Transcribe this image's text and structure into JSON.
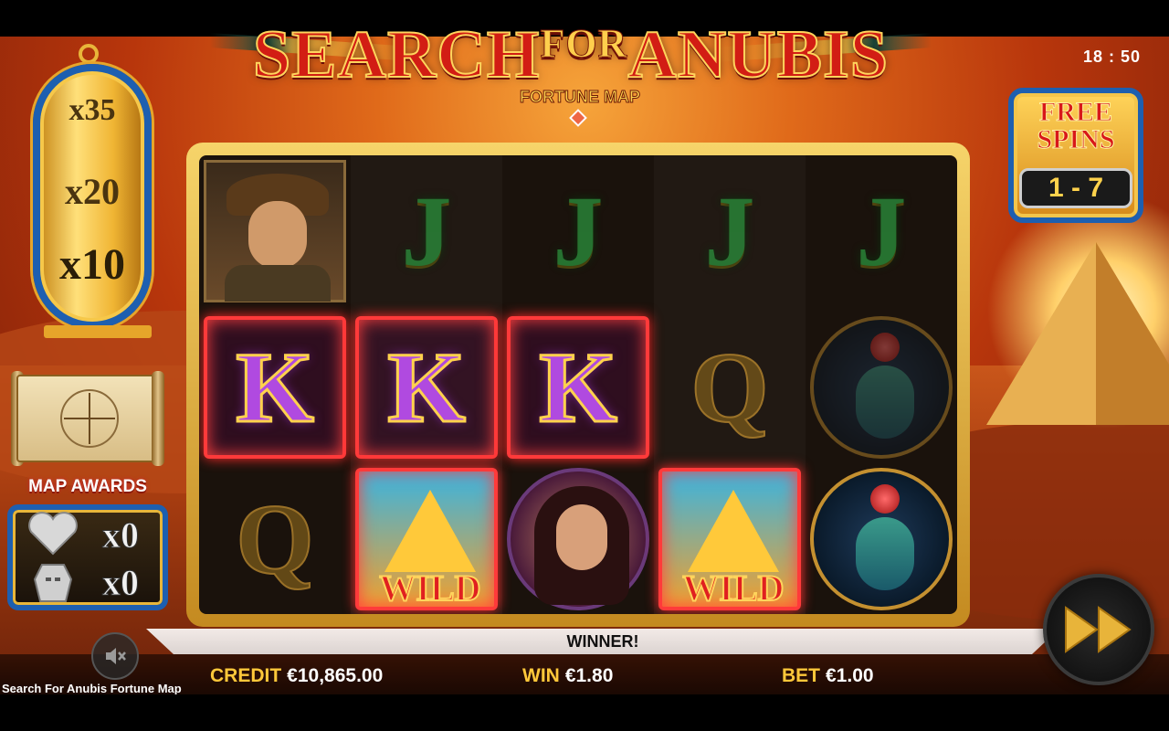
{
  "game": {
    "title": "SEARCH",
    "title_for": "FOR",
    "title_end": "ANUBIS",
    "subtitle": "FORTUNE MAP",
    "name_label": "Search For Anubis Fortune Map"
  },
  "clock": "18 : 50",
  "multipliers": [
    "x35",
    "x20",
    "x10"
  ],
  "map_awards": {
    "label": "MAP AWARDS",
    "items": [
      {
        "icon": "silver-heart-icon",
        "count": "x0"
      },
      {
        "icon": "anubis-mask-icon",
        "count": "x0"
      }
    ]
  },
  "free_spins": {
    "title": "FREE SPINS",
    "range": "1 - 7"
  },
  "reels": [
    [
      "explorer",
      "K",
      "Q"
    ],
    [
      "J",
      "K",
      "WILD"
    ],
    [
      "J",
      "K",
      "queen"
    ],
    [
      "J",
      "Q",
      "WILD"
    ],
    [
      "J",
      "scarab",
      "scarab"
    ]
  ],
  "winning_positions": [
    [
      0,
      1
    ],
    [
      1,
      1
    ],
    [
      2,
      1
    ],
    [
      1,
      2
    ],
    [
      3,
      2
    ]
  ],
  "wild_label": "WILD",
  "status": {
    "winner_text": "WINNER!"
  },
  "meter": {
    "credit_label": "CREDIT",
    "credit_value": "€10,865.00",
    "win_label": "WIN",
    "win_value": "€1.80",
    "bet_label": "BET",
    "bet_value": "€1.00"
  },
  "colors": {
    "accent_gold": "#ffc83a",
    "frame_blue": "#1d5fb0",
    "win_highlight": "#ff3a3a"
  }
}
